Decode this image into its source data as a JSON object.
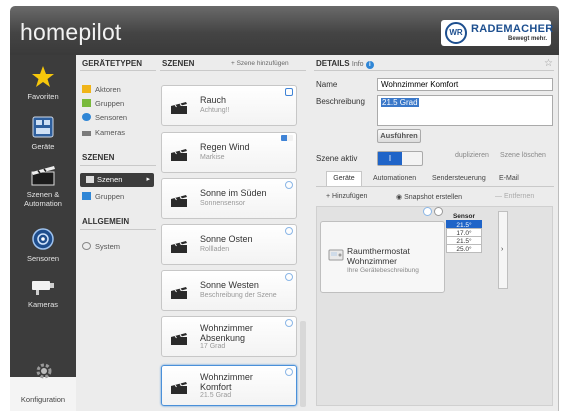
{
  "header": {
    "app_title": "homepilot",
    "brand": {
      "badge": "WR",
      "name": "RADEMACHER",
      "slogan": "Bewegt mehr."
    }
  },
  "sidebar": {
    "items": [
      {
        "label": "Favoriten",
        "icon": "star-icon"
      },
      {
        "label": "Geräte",
        "icon": "devices-icon"
      },
      {
        "label": "Szenen & Automation",
        "icon": "scene-icon"
      },
      {
        "label": "Sensoren",
        "icon": "sensor-icon"
      },
      {
        "label": "Kameras",
        "icon": "camera-icon"
      },
      {
        "label": "Konfiguration",
        "icon": "gear-icon"
      }
    ]
  },
  "types_column": {
    "heading": "GERÄTETYPEN",
    "device_types": [
      "Aktoren",
      "Gruppen",
      "Sensoren",
      "Kameras"
    ],
    "scenes_heading": "SZENEN",
    "scene_types": [
      {
        "label": "Szenen",
        "selected": true
      },
      {
        "label": "Gruppen",
        "selected": false
      }
    ],
    "general_heading": "ALLGEMEIN",
    "general_items": [
      "System"
    ]
  },
  "scenes_column": {
    "heading": "SZENEN",
    "add_label": "+ Szene hinzufügen",
    "scenes": [
      {
        "title": "Rauch",
        "subtitle": "Achtung!!"
      },
      {
        "title": "Regen Wind",
        "subtitle": "Markise"
      },
      {
        "title": "Sonne im Süden",
        "subtitle": "Sonnensensor"
      },
      {
        "title": "Sonne Osten",
        "subtitle": "Rollladen"
      },
      {
        "title": "Sonne Westen",
        "subtitle": "Beschreibung der Szene"
      },
      {
        "title": "Wohnzimmer\nAbsenkung",
        "subtitle": "17 Grad"
      },
      {
        "title": "Wohnzimmer\nKomfort",
        "subtitle": "21.5 Grad"
      }
    ]
  },
  "details": {
    "heading": "DETAILS",
    "info_label": "Info",
    "name_label": "Name",
    "name_value": "Wohnzimmer Komfort",
    "description_label": "Beschreibung",
    "description_value": "21.5 Grad",
    "run_button": "Ausführen",
    "scene_active_label": "Szene aktiv",
    "toggle_value": "I",
    "duplicate_label": "duplizieren",
    "delete_label": "Szene löschen",
    "tabs": [
      "Geräte",
      "Automationen",
      "Sendersteuerung",
      "E-Mail"
    ],
    "tools": [
      "+ Hinzufügen",
      "Snapshot erstellen",
      "— Entfernen"
    ],
    "device": {
      "name_line1": "Raumthermostat",
      "name_line2": "Wohnzimmer",
      "description": "Ihre Gerätebeschreibung",
      "sensor_header": "Sensor",
      "sensor_values": [
        "21.5°",
        "17.0°",
        "21.5°",
        "25.0°"
      ],
      "selected_index": 0
    }
  },
  "colors": {
    "header_dark": "#444444",
    "sidebar": "#3c3c3c",
    "accent_blue": "#1f64c8",
    "star_yellow": "#f6c70b"
  }
}
